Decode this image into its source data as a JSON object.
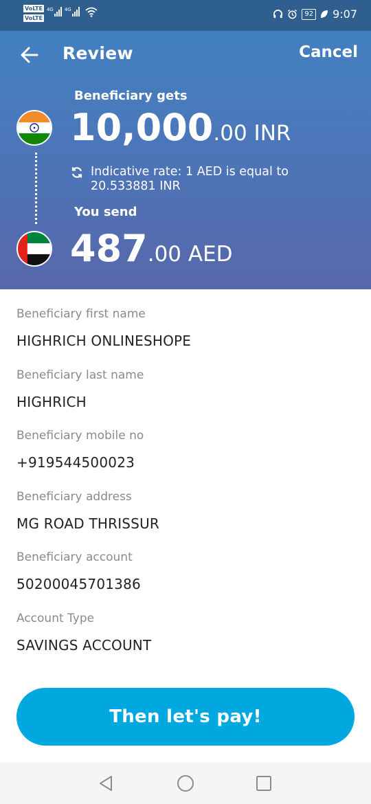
{
  "status_bar": {
    "volte_1": "VoLTE",
    "volte_2": "VoLTE",
    "network_1": "4G",
    "network_2": "4G",
    "battery": "92",
    "time": "9:07",
    "icons": [
      "headset-icon",
      "alarm-icon",
      "battery-icon",
      "leaf-icon",
      "wifi-icon",
      "signal-icon"
    ]
  },
  "header": {
    "title": "Review",
    "cancel_label": "Cancel",
    "back_icon": "back-arrow-icon"
  },
  "summary": {
    "gets_label": "Beneficiary gets",
    "gets_amount_whole": "10,000",
    "gets_amount_fraction": ".00 INR",
    "rate_text": "Indicative rate: 1 AED is equal to 20.533881 INR",
    "send_label": "You send",
    "send_amount_whole": "487",
    "send_amount_fraction": ".00 AED",
    "gets_flag": "india-flag-icon",
    "send_flag": "uae-flag-icon"
  },
  "details": [
    {
      "label": "Beneficiary first name",
      "value": "HIGHRICH ONLINESHOPE"
    },
    {
      "label": "Beneficiary last name",
      "value": "HIGHRICH"
    },
    {
      "label": "Beneficiary mobile no",
      "value": "+919544500023"
    },
    {
      "label": "Beneficiary address",
      "value": "MG ROAD THRISSUR"
    },
    {
      "label": "Beneficiary account",
      "value": "50200045701386"
    },
    {
      "label": "Account Type",
      "value": "SAVINGS ACCOUNT"
    }
  ],
  "pay_button_label": "Then let's pay!",
  "colors": {
    "accent": "#00a8e0",
    "header_top": "#3f83c2",
    "header_bottom": "#5867ab",
    "label_gray": "#8a8a8a",
    "value_dark": "#222222"
  }
}
